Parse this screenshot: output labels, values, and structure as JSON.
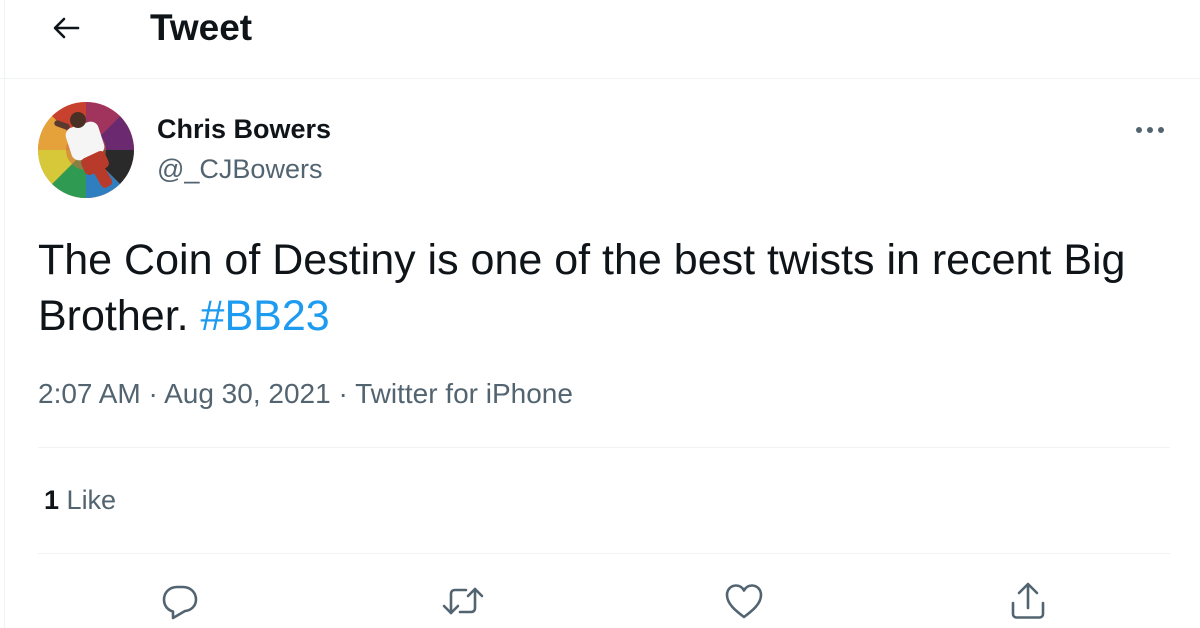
{
  "header": {
    "title": "Tweet",
    "back_icon": "arrow-left-icon"
  },
  "author": {
    "name": "Chris Bowers",
    "handle": "@_CJBowers"
  },
  "tweet": {
    "text": "The Coin of Destiny is one of the best twists in recent Big Brother.",
    "hashtag": "#BB23"
  },
  "meta": {
    "time": "2:07 AM",
    "date": "Aug 30, 2021",
    "source": "Twitter for iPhone",
    "separator": "·"
  },
  "stats": {
    "likes_count": "1",
    "likes_label": "Like"
  },
  "actions": [
    {
      "icon": "reply-icon"
    },
    {
      "icon": "retweet-icon"
    },
    {
      "icon": "like-icon"
    },
    {
      "icon": "share-icon"
    }
  ],
  "colors": {
    "text": "#0f1419",
    "secondary": "#536471",
    "accent": "#1d9bf0",
    "divider": "#eff3f4"
  }
}
